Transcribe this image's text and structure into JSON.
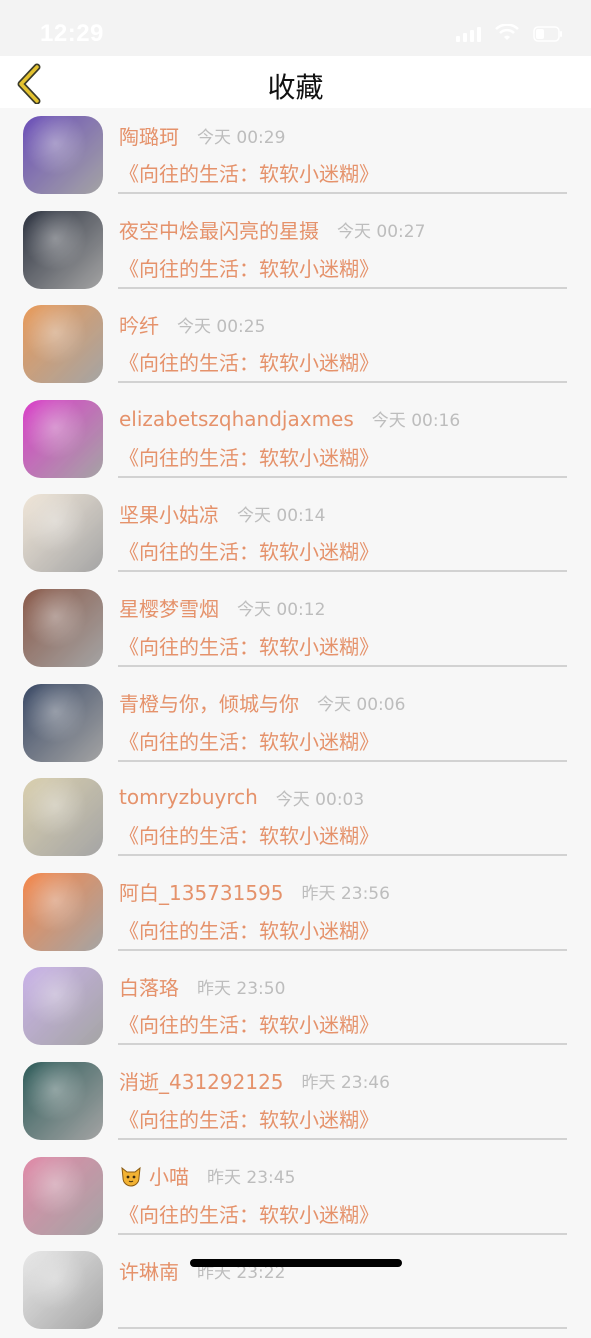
{
  "status_bar": {
    "time": "12:29"
  },
  "header": {
    "title": "收藏"
  },
  "favorites": [
    {
      "name": "陶璐珂",
      "time": "今天 00:29",
      "title": "《向往的生活：软软小迷糊》"
    },
    {
      "name": "夜空中烩最闪亮的星摄",
      "time": "今天 00:27",
      "title": "《向往的生活：软软小迷糊》"
    },
    {
      "name": "昑纤",
      "time": "今天 00:25",
      "title": "《向往的生活：软软小迷糊》"
    },
    {
      "name": "elizabetszqhandjaxmes",
      "time": "今天 00:16",
      "title": "《向往的生活：软软小迷糊》"
    },
    {
      "name": "坚果小姑凉",
      "time": "今天 00:14",
      "title": "《向往的生活：软软小迷糊》"
    },
    {
      "name": "星樱梦雪烟",
      "time": "今天 00:12",
      "title": "《向往的生活：软软小迷糊》"
    },
    {
      "name": "青橙与你，倾城与你",
      "time": "今天 00:06",
      "title": "《向往的生活：软软小迷糊》"
    },
    {
      "name": "tomryzbuyrch",
      "time": "今天 00:03",
      "title": "《向往的生活：软软小迷糊》"
    },
    {
      "name": "阿白_135731595",
      "time": "昨天 23:56",
      "title": "《向往的生活：软软小迷糊》"
    },
    {
      "name": "白落珞",
      "time": "昨天 23:50",
      "title": "《向往的生活：软软小迷糊》"
    },
    {
      "name": "消逝_431292125",
      "time": "昨天 23:46",
      "title": "《向往的生活：软软小迷糊》"
    },
    {
      "name": "小喵",
      "time": "昨天 23:45",
      "title": "《向往的生活：软软小迷糊》",
      "name_icon": "cat-face-icon"
    },
    {
      "name": "许琳南",
      "time": "昨天 23:22",
      "title": ""
    }
  ],
  "avatar_colors": [
    "#6b4fb8",
    "#2d3340",
    "#e89a5a",
    "#d940c8",
    "#f0e6d8",
    "#8a5a4a",
    "#3b4a66",
    "#d9cfae",
    "#f4874b",
    "#c9b2e8",
    "#2f5c5a",
    "#e08aa8",
    "#e8e8e8"
  ],
  "colors": {
    "accent": "#e5926b",
    "meta": "#bdbdbd",
    "back_chevron": "#e3c230"
  }
}
